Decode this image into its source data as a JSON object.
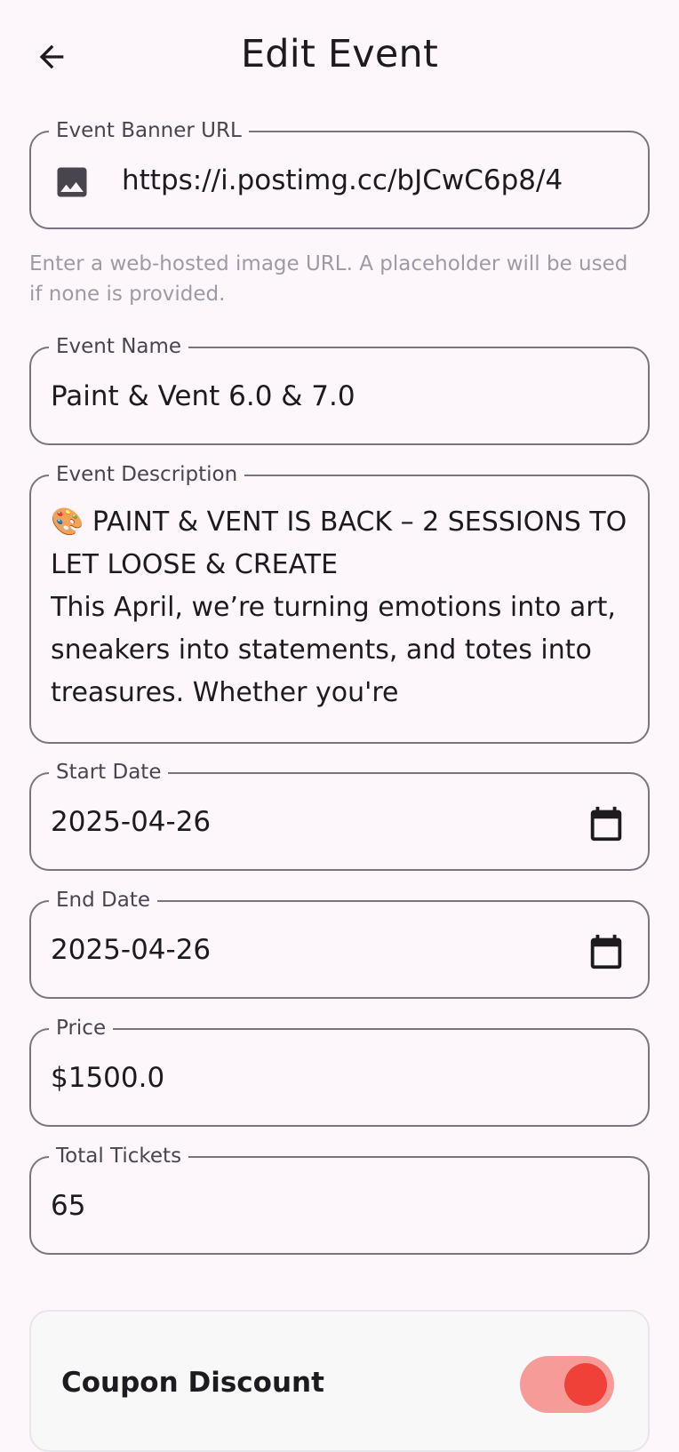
{
  "header": {
    "title": "Edit Event"
  },
  "form": {
    "banner_url": {
      "label": "Event Banner URL",
      "value": "https://i.postimg.cc/bJCwC6p8/4",
      "helper": "Enter a web-hosted image URL. A placeholder will be used if none is provided."
    },
    "event_name": {
      "label": "Event Name",
      "value": "Paint & Vent 6.0 & 7.0"
    },
    "event_description": {
      "label": "Event Description",
      "value": "🎨 PAINT & VENT IS BACK – 2 SESSIONS TO LET LOOSE & CREATE\nThis April, we’re turning emotions into art, sneakers into statements, and totes into treasures. Whether you're"
    },
    "start_date": {
      "label": "Start Date",
      "value": "2025-04-26"
    },
    "end_date": {
      "label": "End Date",
      "value": "2025-04-26"
    },
    "price": {
      "label": "Price",
      "value": "$1500.0"
    },
    "total_tickets": {
      "label": "Total Tickets",
      "value": "65"
    }
  },
  "coupon": {
    "title": "Coupon Discount",
    "enabled": true
  },
  "colors": {
    "accent": "#ef4137",
    "switch_track": "#f69b98",
    "outline": "#79747e",
    "background": "#fdf7fc"
  },
  "icons": {
    "back": "arrow-left-icon",
    "banner": "image-icon",
    "date": "calendar-icon"
  }
}
